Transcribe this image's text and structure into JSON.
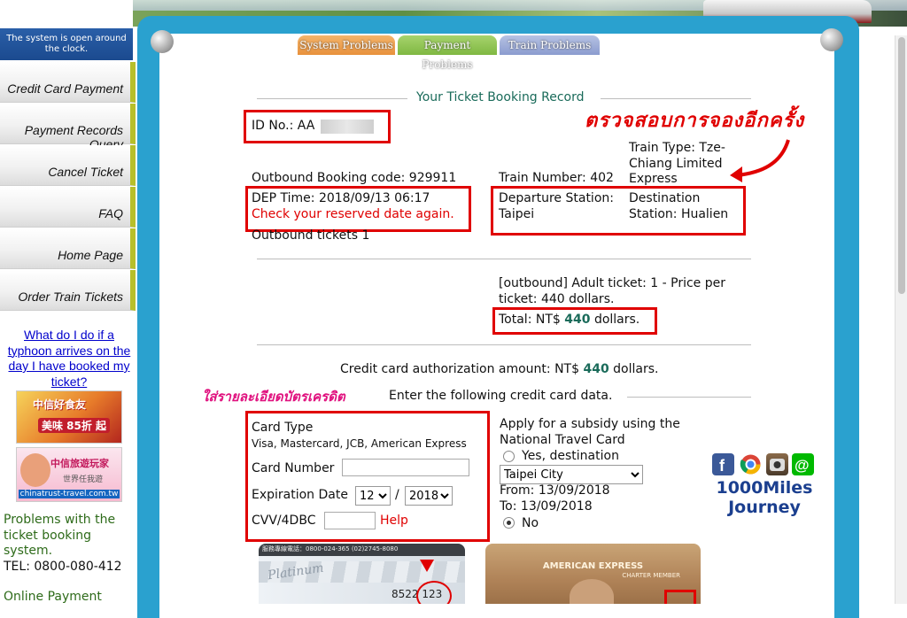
{
  "sidebar": {
    "notice": "The system is open around the clock.",
    "items": [
      {
        "label": "Credit Card Payment"
      },
      {
        "label": "Payment Records Query"
      },
      {
        "label": "Cancel Ticket"
      },
      {
        "label": "FAQ"
      },
      {
        "label": "Home Page"
      },
      {
        "label": "Order Train Tickets"
      }
    ],
    "typhoon_link": "What do I do if a typhoon arrives on the day I have booked my ticket?",
    "ad1": {
      "title": "中信好食友",
      "badge": "美味 85折 起"
    },
    "ad2": {
      "title": "中信旅遊玩家",
      "subtitle": "世界任我遊",
      "url": "chinatrust-travel.com.tw"
    },
    "problems_text": "Problems with the ticket booking system.",
    "tel": "TEL: 0800-080-412",
    "online_payment": "Online Payment"
  },
  "tabs": [
    {
      "label": "System Problems"
    },
    {
      "label": "Payment Problems"
    },
    {
      "label": "Train Problems"
    }
  ],
  "record": {
    "title": "Your Ticket Booking Record",
    "id_label": "ID No.: AA",
    "outbound_code": "Outbound Booking code: 929911",
    "train_number": "Train Number: 402",
    "train_type": "Train Type: Tze-Chiang Limited Express",
    "dep_time": "DEP Time: 2018/09/13 06:17",
    "check_date": "Check your reserved date again.",
    "departure_station": "Departure Station: Taipei",
    "destination_station": "Destination Station: Hualien",
    "outbound_tickets": "Outbound tickets 1",
    "price_line": "[outbound] Adult ticket: 1 - Price per ticket: 440 dollars.",
    "total_prefix": "Total: NT$",
    "total_amount": "440",
    "total_suffix": "dollars.",
    "auth_prefix": "Credit card authorization amount: NT$",
    "auth_amount": "440",
    "auth_suffix": "dollars.",
    "enter_data": "Enter the following credit card data."
  },
  "annotations": {
    "thai_check_again": "ตรวจสอบการจองอีกครั้ง",
    "thai_card_details": "ใส่รายละเอียดบัตรเครดิต"
  },
  "form": {
    "card_type_label": "Card Type",
    "card_types": "Visa, Mastercard, JCB, American Express",
    "card_number_label": "Card Number",
    "card_number_value": "",
    "expiration_label": "Expiration Date",
    "exp_month": "12",
    "exp_sep": "/",
    "exp_year": "2018",
    "cvv_label": "CVV/4DBC",
    "cvv_value": "",
    "help_link": "Help"
  },
  "subsidy": {
    "heading": "Apply for a subsidy using the National Travel Card",
    "yes_label": "Yes, destination",
    "city_select": "Taipei City",
    "from": "From: 13/09/2018",
    "to": "To: 13/09/2018",
    "no_label": "No",
    "selected": "No"
  },
  "cards": {
    "card1_text": "Platinum",
    "card1_phone": "服務專線電話：0800-024-365 (02)2745-8080",
    "card1_number": "8522 123",
    "card2_brand": "AMERICAN EXPRESS",
    "card2_sub": "CHARTER MEMBER"
  },
  "brand": {
    "line1": "1000Miles",
    "line2": "Journey",
    "icons": [
      "facebook-icon",
      "chrome-icon",
      "instagram-icon",
      "line-icon"
    ]
  },
  "colors": {
    "frame": "#2aa1cf",
    "highlight_red": "#e00000",
    "amount_green": "#1a6b5a",
    "menu_accent": "#b7bf2a",
    "thai_pink": "#e0117e"
  }
}
